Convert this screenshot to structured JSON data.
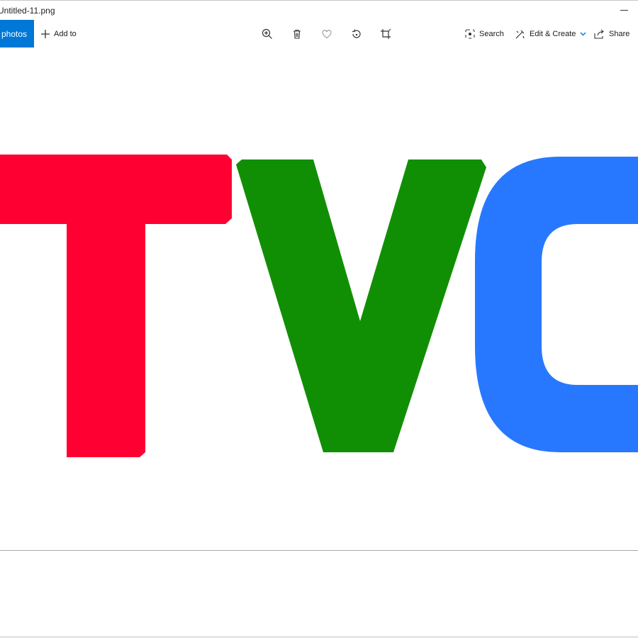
{
  "window": {
    "title": "Untitled-11.png"
  },
  "toolbar": {
    "all_photos_label": "All photos",
    "add_to_label": "Add to",
    "zoom_icon": "zoom-in-icon",
    "delete_icon": "trash-icon",
    "favorite_icon": "heart-icon",
    "rotate_icon": "rotate-icon",
    "crop_icon": "crop-icon",
    "search_label": "Search",
    "edit_create_label": "Edit & Create",
    "share_label": "Share"
  },
  "image": {
    "letters": [
      "T",
      "V",
      "C"
    ],
    "colors": {
      "T": "#ff0033",
      "V": "#118f04",
      "C": "#2878ff"
    }
  },
  "colors": {
    "accent": "#0078d7"
  }
}
